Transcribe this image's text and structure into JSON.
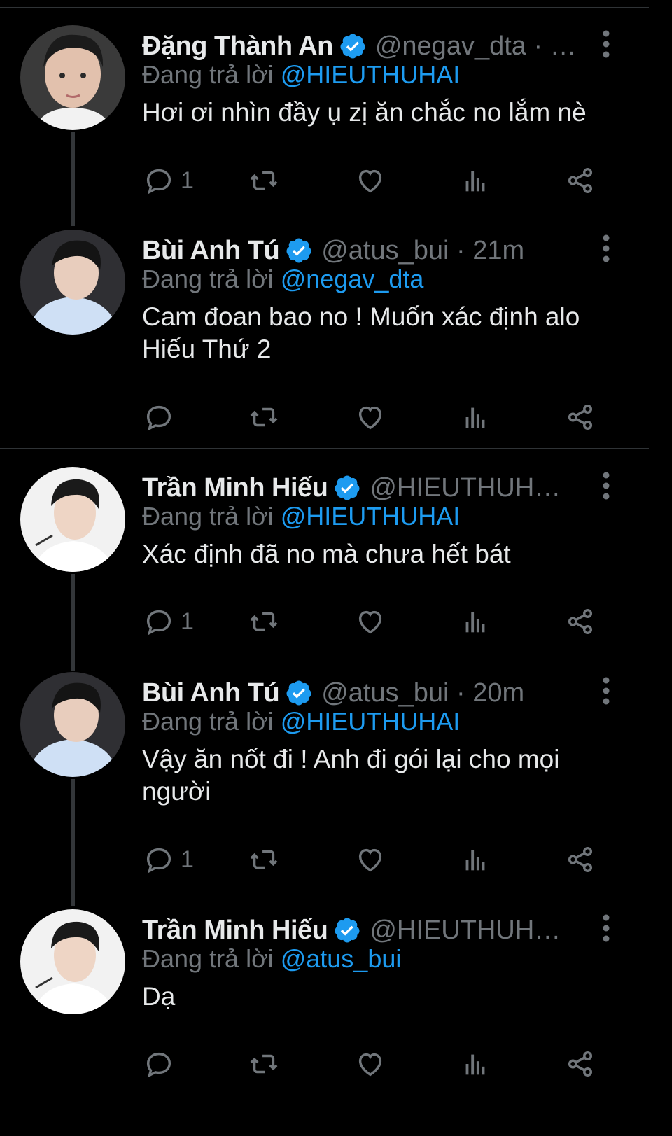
{
  "colors": {
    "background": "#000000",
    "link": "#1d9bf0",
    "muted": "#71767b",
    "verified": "#1d9bf0"
  },
  "reply_prefix": "Đang trả lời",
  "tweets": [
    {
      "name": "Đặng Thành An",
      "handle": "@negav_dta · …",
      "reply_to": "@HIEUTHUHAI",
      "text": "Hơi ơi nhìn đầy ụ zị ăn chắc no lắm nè",
      "reply_count": "1",
      "avatar": "avatar-photo"
    },
    {
      "name": "Bùi Anh Tú",
      "handle": "@atus_bui · 21m",
      "reply_to": "@negav_dta",
      "text": "Cam đoan bao no ! Muốn xác định alo Hiếu Thứ 2",
      "reply_count": "",
      "avatar": "avatar-photo"
    },
    {
      "name": "Trần Minh Hiếu",
      "handle": "@HIEUTHUH…",
      "reply_to": "@HIEUTHUHAI",
      "text": "Xác định đã no mà chưa hết bát",
      "reply_count": "1",
      "avatar": "avatar-photo"
    },
    {
      "name": "Bùi Anh Tú",
      "handle": "@atus_bui · 20m",
      "reply_to": "@HIEUTHUHAI",
      "text": "Vậy ăn nốt đi ! Anh đi gói lại cho mọi người",
      "reply_count": "1",
      "avatar": "avatar-photo"
    },
    {
      "name": "Trần Minh Hiếu",
      "handle": "@HIEUTHUH…",
      "reply_to": "@atus_bui",
      "text": "Dạ",
      "reply_count": "",
      "avatar": "avatar-photo"
    }
  ],
  "icons": [
    "reply-icon",
    "retweet-icon",
    "like-icon",
    "analytics-icon",
    "share-icon",
    "more-icon",
    "verified-badge-icon"
  ]
}
